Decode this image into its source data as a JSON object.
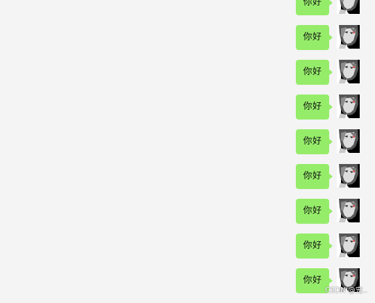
{
  "messages": [
    {
      "text": "你好"
    },
    {
      "text": "你好"
    },
    {
      "text": "你好"
    },
    {
      "text": "你好"
    },
    {
      "text": "你好"
    },
    {
      "text": "你好"
    },
    {
      "text": "你好"
    },
    {
      "text": "你好"
    },
    {
      "text": "你好"
    }
  ],
  "watermark": "CSDN @宠..",
  "colors": {
    "background": "#f4f4f4",
    "bubble": "#95ec69",
    "text": "#111111"
  },
  "icons": {
    "avatar": "anime-girl-avatar-icon"
  }
}
